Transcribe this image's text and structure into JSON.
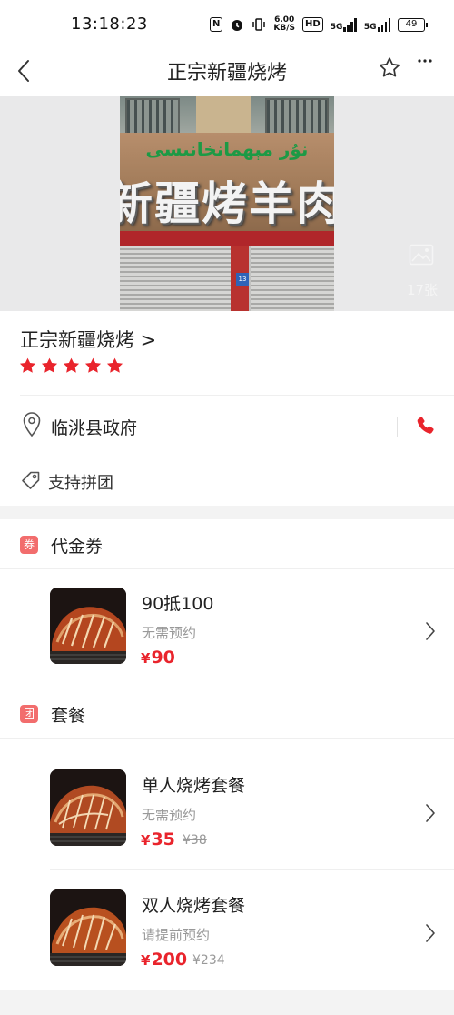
{
  "status_bar": {
    "time": "13:18:23",
    "nfc": "N",
    "speed": "6.00",
    "speed_unit": "KB/S",
    "hd": "HD",
    "net1": "5G",
    "net2": "5G",
    "battery": "49"
  },
  "header": {
    "title": "正宗新疆烧烤"
  },
  "photo": {
    "sign_arabic": "نۇر مېھمانخانىسى",
    "sign_chinese": "新疆烤羊肉",
    "plate": "13",
    "count": "17张"
  },
  "shop": {
    "name": "正宗新疆烧烤 >",
    "rating_stars": 5,
    "location": "临洮县政府",
    "tag": "支持拼团"
  },
  "sections": [
    {
      "badge": "券",
      "title": "代金券",
      "deals": [
        {
          "name": "90抵100",
          "note": "无需预约",
          "yen": "¥",
          "price": "90",
          "original": ""
        }
      ]
    },
    {
      "badge": "团",
      "title": "套餐",
      "deals": [
        {
          "name": "单人烧烤套餐",
          "note": "无需预约",
          "yen": "¥",
          "price": "35",
          "original": "¥38"
        },
        {
          "name": "双人烧烤套餐",
          "note": "请提前预约",
          "yen": "¥",
          "price": "200",
          "original": "¥234"
        }
      ]
    }
  ],
  "colors": {
    "accent": "#e9242c",
    "badge": "#f26d6d",
    "divider": "#efefef",
    "muted_text": "#999999"
  }
}
